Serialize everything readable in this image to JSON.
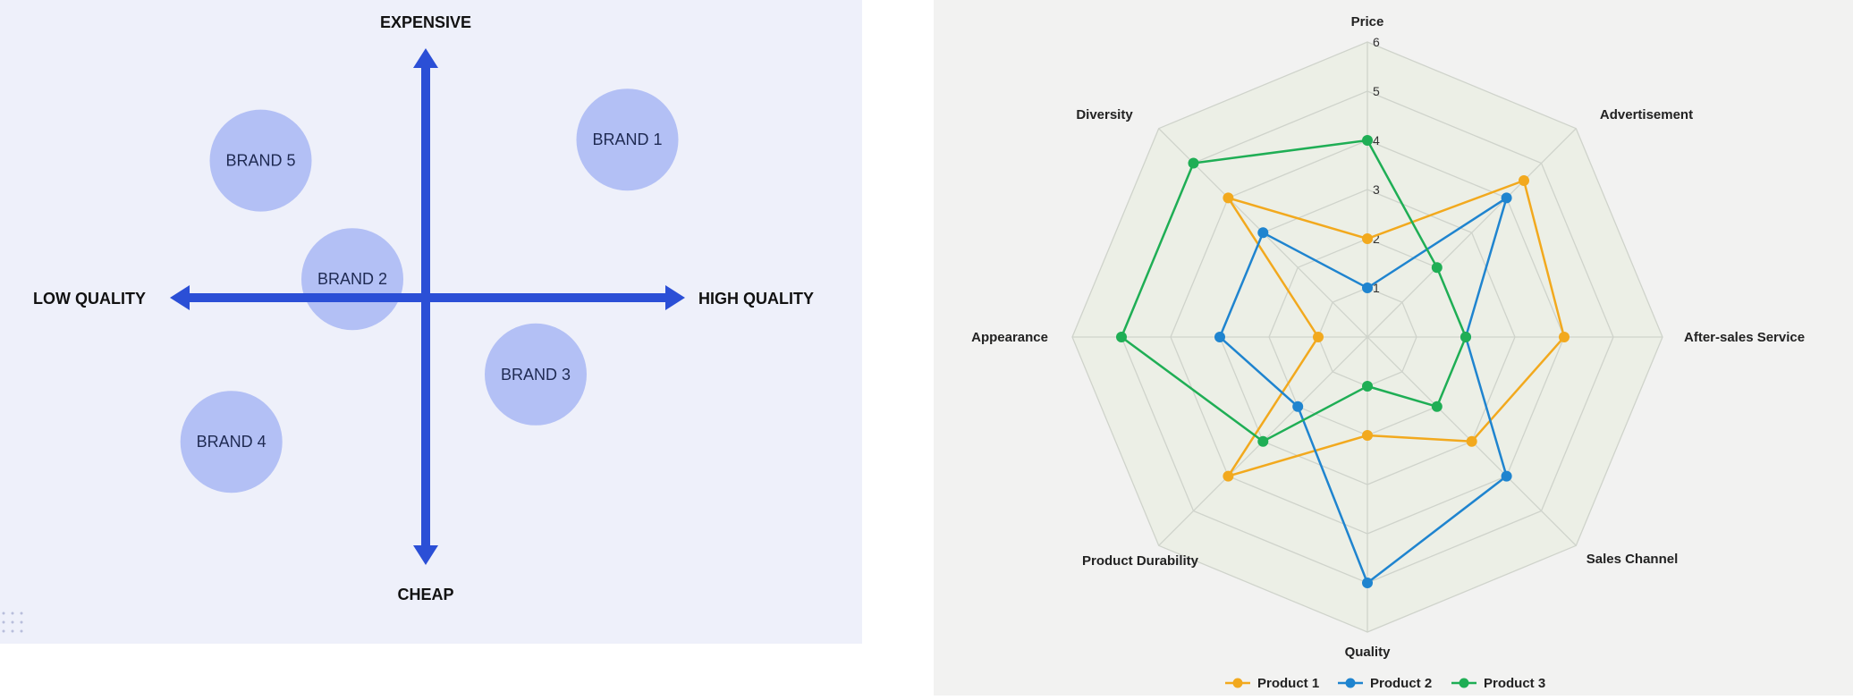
{
  "colors": {
    "panel_bg_left": "#eef0fa",
    "axis_blue": "#2b4fd6",
    "brand_bubble": "#b3c0f5",
    "panel_bg_right": "#f2f2f1",
    "radar_fill": "#ecefe6",
    "radar_grid": "#cfd3cb",
    "product1": "#f2a91e",
    "product2": "#1f84cf",
    "product3": "#1fae55"
  },
  "chart_data": [
    {
      "type": "scatter",
      "subtype": "perceptual-map",
      "x_axis": {
        "negative_label": "LOW QUALITY",
        "positive_label": "HIGH QUALITY"
      },
      "y_axis": {
        "positive_label": "EXPENSIVE",
        "negative_label": "CHEAP"
      },
      "xlim": [
        -1,
        1
      ],
      "ylim": [
        -1,
        1
      ],
      "points": [
        {
          "label": "BRAND 1",
          "x": 0.55,
          "y": 0.68
        },
        {
          "label": "BRAND 5",
          "x": -0.45,
          "y": 0.59
        },
        {
          "label": "BRAND 2",
          "x": -0.2,
          "y": 0.08
        },
        {
          "label": "BRAND 3",
          "x": 0.3,
          "y": -0.33
        },
        {
          "label": "BRAND 4",
          "x": -0.53,
          "y": -0.62
        }
      ]
    },
    {
      "type": "radar",
      "axes": [
        "Price",
        "Advertisement",
        "After-sales Service",
        "Sales Channel",
        "Quality",
        "Product Durability",
        "Appearance",
        "Diversity"
      ],
      "rlim": [
        0,
        6
      ],
      "ticks": [
        "1",
        "2",
        "3",
        "4",
        "5",
        "6"
      ],
      "grid": true,
      "legend_position": "bottom",
      "series": [
        {
          "name": "Product 1",
          "values": [
            2,
            4.5,
            4,
            3,
            2,
            4,
            1,
            4
          ]
        },
        {
          "name": "Product 2",
          "values": [
            1,
            4,
            2,
            4,
            5,
            2,
            3,
            3
          ]
        },
        {
          "name": "Product 3",
          "values": [
            4,
            2,
            2,
            2,
            1,
            3,
            5,
            5
          ]
        }
      ]
    }
  ]
}
